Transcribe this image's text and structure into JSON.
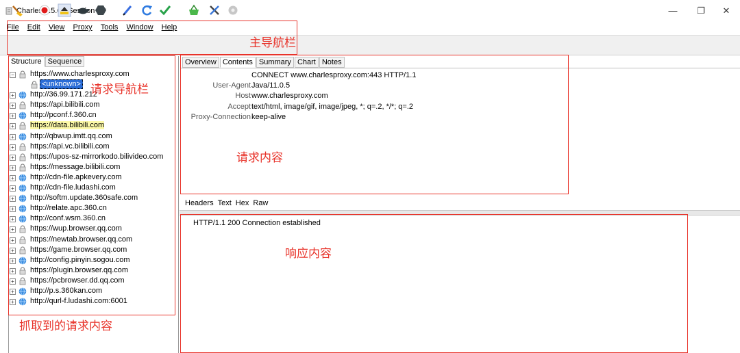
{
  "window": {
    "title": "Charles 4.5.6 - Session 1 *",
    "min_glyph": "—",
    "max_glyph": "❐",
    "close_glyph": "✕"
  },
  "menu": [
    "File",
    "Edit",
    "View",
    "Proxy",
    "Tools",
    "Window",
    "Help"
  ],
  "toolbar": {
    "icons": [
      "broom-icon",
      "record-icon",
      "throttle-icon",
      "turtle-icon",
      "breakpoint-icon",
      "pen-icon",
      "refresh-icon",
      "validate-check-icon",
      "basket-icon",
      "tools-icon",
      "settings-gear-icon"
    ]
  },
  "left_tabs": [
    "Structure",
    "Sequence"
  ],
  "tree": [
    {
      "label": "https://www.charlesproxy.com",
      "expanded": true,
      "secure": true,
      "highlight": false
    },
    {
      "label": "<unknown>",
      "child": true
    },
    {
      "label": "http://36.99.171.212",
      "secure": false
    },
    {
      "label": "https://api.bilibili.com",
      "secure": true
    },
    {
      "label": "http://pconf.f.360.cn",
      "secure": false
    },
    {
      "label": "https://data.bilibili.com",
      "secure": true,
      "highlight": true
    },
    {
      "label": "http://qbwup.imtt.qq.com",
      "secure": false
    },
    {
      "label": "https://api.vc.bilibili.com",
      "secure": true
    },
    {
      "label": "https://upos-sz-mirrorkodo.bilivideo.com",
      "secure": true
    },
    {
      "label": "https://message.bilibili.com",
      "secure": true
    },
    {
      "label": "http://cdn-file.apkevery.com",
      "secure": false
    },
    {
      "label": "http://cdn-file.ludashi.com",
      "secure": false
    },
    {
      "label": "http://softm.update.360safe.com",
      "secure": false
    },
    {
      "label": "http://relate.apc.360.cn",
      "secure": false
    },
    {
      "label": "http://conf.wsm.360.cn",
      "secure": false
    },
    {
      "label": "https://wup.browser.qq.com",
      "secure": true
    },
    {
      "label": "https://newtab.browser.qq.com",
      "secure": true
    },
    {
      "label": "https://game.browser.qq.com",
      "secure": true
    },
    {
      "label": "http://config.pinyin.sogou.com",
      "secure": false
    },
    {
      "label": "https://plugin.browser.qq.com",
      "secure": true
    },
    {
      "label": "https://pcbrowser.dd.qq.com",
      "secure": true
    },
    {
      "label": "http://p.s.360kan.com",
      "secure": false
    },
    {
      "label": "http://qurl-f.ludashi.com:6001",
      "secure": false
    }
  ],
  "right_tabs": [
    "Overview",
    "Contents",
    "Summary",
    "Chart",
    "Notes"
  ],
  "active_right_tab": "Contents",
  "request": {
    "first_line": "CONNECT www.charlesproxy.com:443 HTTP/1.1",
    "headers": [
      {
        "key": "User-Agent",
        "value": "Java/11.0.5"
      },
      {
        "key": "Host",
        "value": "www.charlesproxy.com"
      },
      {
        "key": "Accept",
        "value": "text/html, image/gif, image/jpeg, *; q=.2, */*; q=.2"
      },
      {
        "key": "Proxy-Connection",
        "value": "keep-alive"
      }
    ]
  },
  "bottom_tabs": [
    "Headers",
    "Text",
    "Hex",
    "Raw"
  ],
  "active_bottom_tab": "Headers",
  "response": {
    "status_line": "HTTP/1.1 200 Connection established"
  },
  "annotations": {
    "main_nav": "主导航栏",
    "request_nav": "请求导航栏",
    "request_content": "请求内容",
    "response_content": "响应内容",
    "captured": "抓取到的请求内容"
  },
  "colors": {
    "annotation_red": "#e8332a",
    "selection_blue": "#2a6cd6",
    "highlight_yellow": "#fcf9a8"
  }
}
